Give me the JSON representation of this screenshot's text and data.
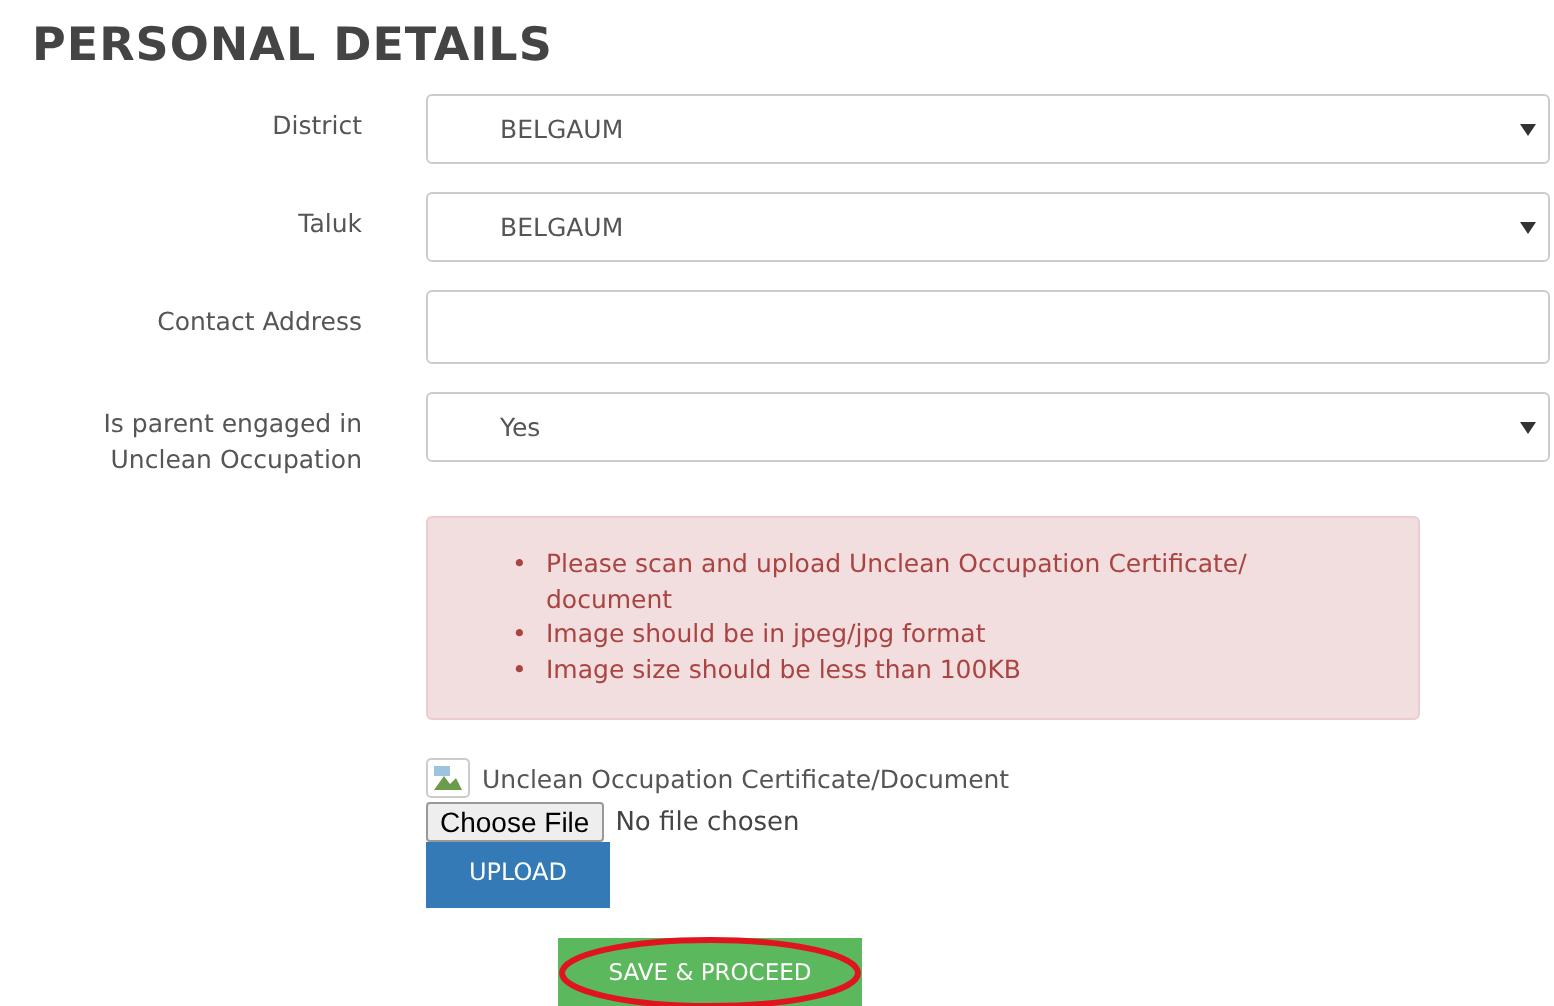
{
  "heading": "PERSONAL DETAILS",
  "fields": [
    {
      "label": "District",
      "kind": "select",
      "value": "BELGAUM"
    },
    {
      "label": "Taluk",
      "kind": "select",
      "value": "BELGAUM"
    },
    {
      "label": "Contact Address",
      "kind": "text"
    },
    {
      "label": "Is parent engaged in Unclean Occupation",
      "kind": "select",
      "value": "Yes"
    }
  ],
  "notice": {
    "items": [
      {
        "marker": "•",
        "text": "Please scan and upload Unclean Occupation Certificate/ document"
      },
      {
        "marker": "•",
        "text": "Image should be in jpeg/jpg format"
      },
      {
        "marker": "•",
        "text": "Image size should be less than 100KB"
      }
    ]
  },
  "upload": {
    "caption": "Unclean Occupation Certificate/Document",
    "file_button": "Choose File",
    "file_status": "No file chosen",
    "upload_button": "UPLOAD"
  },
  "submit": {
    "label": "SAVE & PROCEED",
    "highlighted": true
  }
}
